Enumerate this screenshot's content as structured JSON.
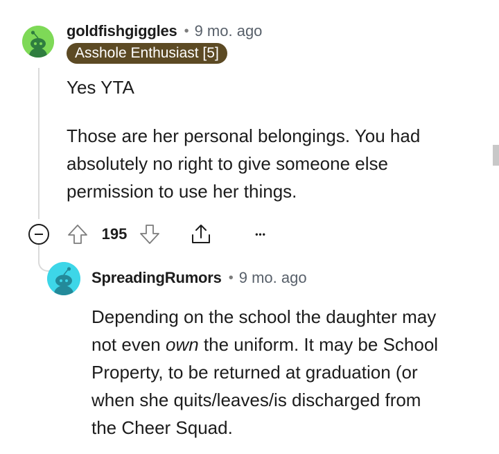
{
  "comment": {
    "username": "goldfishgiggles",
    "separator": "•",
    "time": "9 mo. ago",
    "flair": "Asshole Enthusiast [5]",
    "body_p1": "Yes YTA",
    "body_p2_l1": "Those are her personal belongings. You had",
    "body_p2_l2": "absolutely no right to give someone else",
    "body_p2_l3": "permission to use her things.",
    "score": "195",
    "avatar_color": "#7ed957",
    "more_label": "•••"
  },
  "reply": {
    "username": "SpreadingRumors",
    "separator": "•",
    "time": "9 mo. ago",
    "line1": "Depending on the school the daughter may",
    "line2_pre": "not even ",
    "line2_em": "own",
    "line2_post": " the uniform. It may be School",
    "line3": "Property, to be returned at graduation (or",
    "line4": "when she quits/leaves/is discharged from",
    "line5": "the Cheer Squad.",
    "avatar_color": "#3dd6e8"
  },
  "icons": {
    "collapse": "minus-circle-icon",
    "upvote": "arrow-up-icon",
    "downvote": "arrow-down-icon",
    "share": "share-icon",
    "more": "more-dots-icon"
  }
}
